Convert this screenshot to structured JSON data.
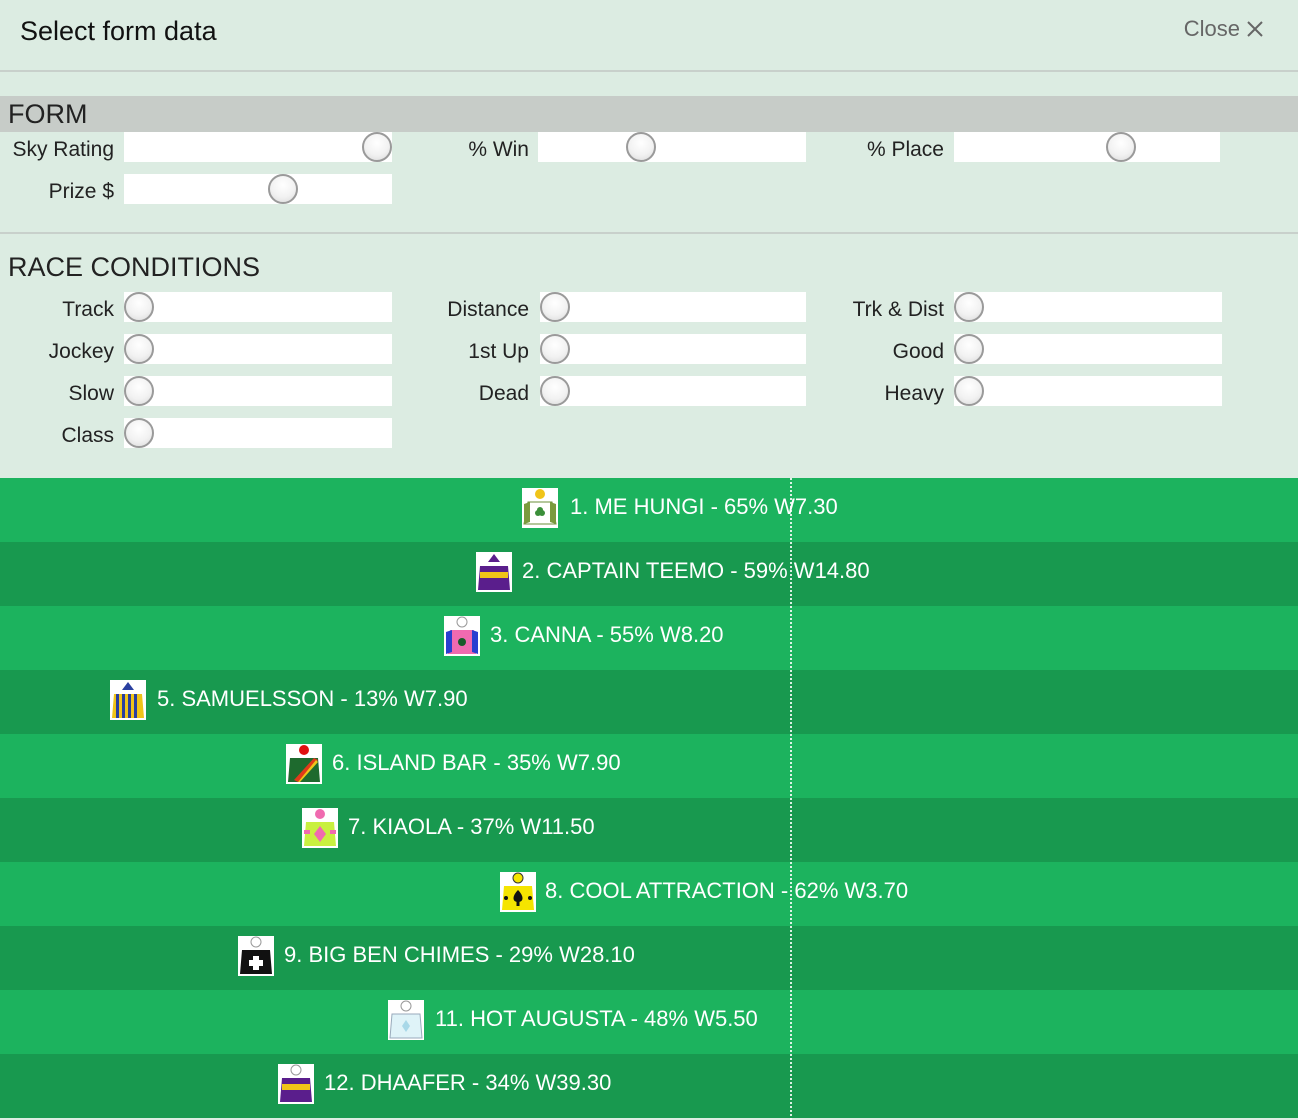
{
  "dialog": {
    "title": "Select form data",
    "close_label": "Close"
  },
  "form": {
    "heading": "FORM",
    "fields": [
      {
        "label": "Sky Rating"
      },
      {
        "label": "% Win"
      },
      {
        "label": "% Place"
      },
      {
        "label": "Prize $"
      }
    ]
  },
  "race_conditions": {
    "heading": "RACE CONDITIONS",
    "fields": [
      {
        "label": "Track"
      },
      {
        "label": "Distance"
      },
      {
        "label": "Trk & Dist"
      },
      {
        "label": "Jockey"
      },
      {
        "label": "1st Up"
      },
      {
        "label": "Good"
      },
      {
        "label": "Slow"
      },
      {
        "label": "Dead"
      },
      {
        "label": "Heavy"
      },
      {
        "label": "Class"
      }
    ]
  },
  "runners": [
    {
      "text": "1. ME HUNGI - 65% W7.30",
      "silk": "silk-white-green-clover-icon"
    },
    {
      "text": "2. CAPTAIN TEEMO - 59% W14.80",
      "silk": "silk-purple-yellow-icon"
    },
    {
      "text": "3. CANNA - 55% W8.20",
      "silk": "silk-pink-blue-icon"
    },
    {
      "text": "5. SAMUELSSON - 13% W7.90",
      "silk": "silk-blue-yellow-stripes-icon"
    },
    {
      "text": "6. ISLAND BAR - 35% W7.90",
      "silk": "silk-green-red-sash-icon"
    },
    {
      "text": "7. KIAOLA - 37% W11.50",
      "silk": "silk-lime-pink-icon"
    },
    {
      "text": "8. COOL ATTRACTION - 62% W3.70",
      "silk": "silk-yellow-black-spade-icon"
    },
    {
      "text": "9. BIG BEN CHIMES - 29% W28.10",
      "silk": "silk-black-white-cross-icon"
    },
    {
      "text": "11. HOT AUGUSTA - 48% W5.50",
      "silk": "silk-pale-blue-icon"
    },
    {
      "text": "12. DHAAFER - 34% W39.30",
      "silk": "silk-purple-yellow-icon"
    }
  ]
}
